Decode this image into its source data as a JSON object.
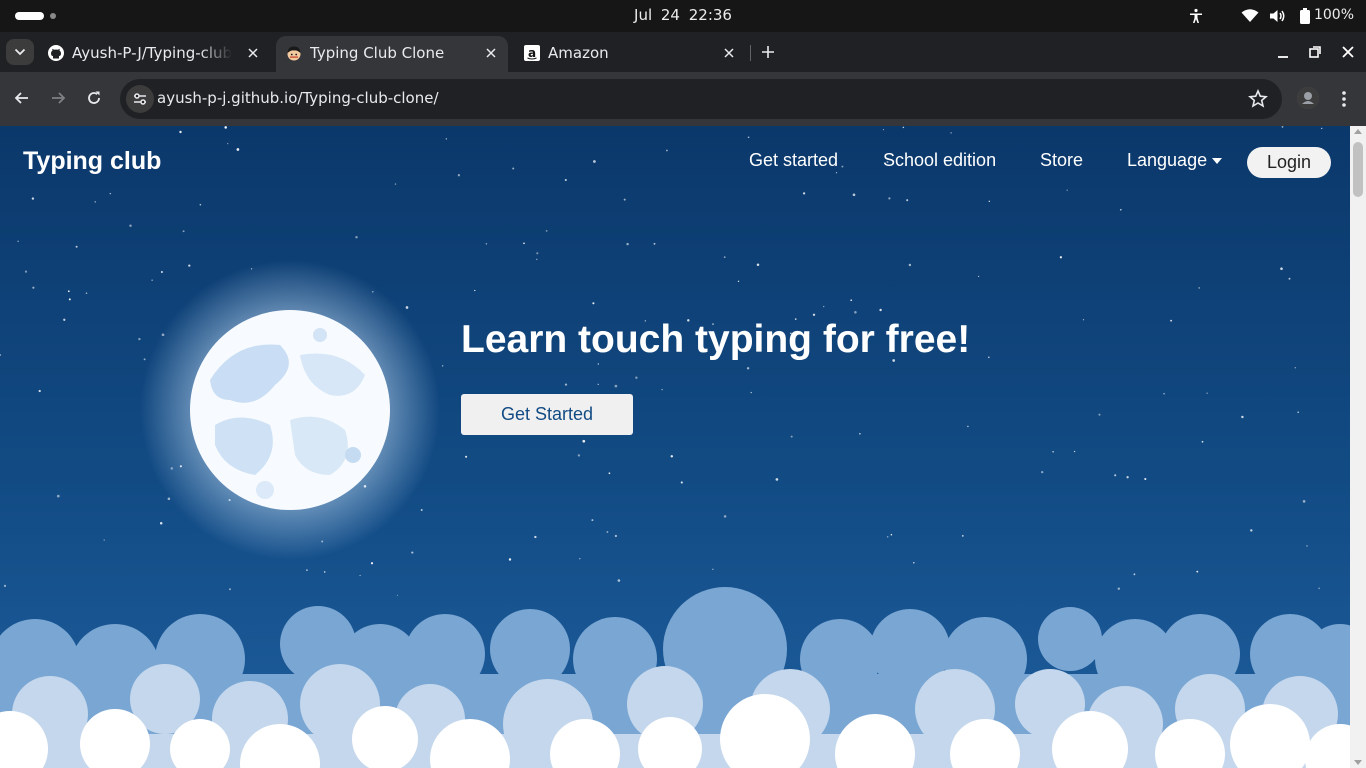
{
  "os": {
    "clock": "Jul 24  22:36",
    "battery_percent": "100%",
    "icons": [
      "accessibility-icon",
      "wifi-icon",
      "volume-icon",
      "battery-icon"
    ]
  },
  "browser": {
    "tabs": [
      {
        "title": "Ayush-P-J/Typing-club-clone",
        "favicon": "github-icon",
        "active": false
      },
      {
        "title": "Typing Club Clone",
        "favicon": "typing-club-icon",
        "active": true
      },
      {
        "title": "Amazon",
        "favicon": "amazon-icon",
        "active": false
      }
    ],
    "url": "ayush-p-j.github.io/Typing-club-clone/"
  },
  "page": {
    "brand": "Typing club",
    "nav": {
      "get_started": "Get started",
      "school_edition": "School edition",
      "store": "Store",
      "language": "Language",
      "login": "Login"
    },
    "hero": {
      "title": "Learn touch typing for free!",
      "cta": "Get Started"
    },
    "colors": {
      "sky_top": "#0b386b",
      "sky_bottom": "#1e5e9e",
      "cta_text": "#124b84"
    }
  }
}
